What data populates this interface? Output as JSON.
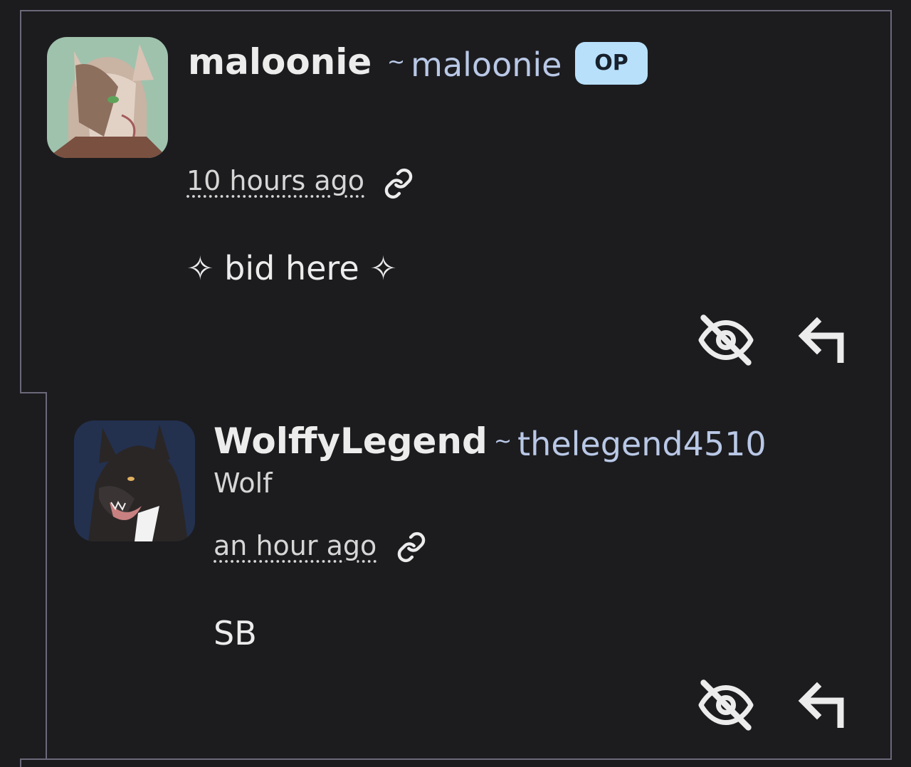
{
  "comments": [
    {
      "display_name": "maloonie",
      "username_prefix": "~",
      "username": "maloonie",
      "badge": "OP",
      "species": "",
      "timestamp": "10 hours ago",
      "body": "✧ bid here ✧",
      "icons": {
        "permalink": "link-icon",
        "hide": "eye-off-icon",
        "reply": "reply-arrow-icon"
      }
    },
    {
      "display_name": "WolffyLegend",
      "username_prefix": "~",
      "username": "thelegend4510",
      "badge": "",
      "species": "Wolf",
      "timestamp": "an hour ago",
      "body": "SB",
      "icons": {
        "permalink": "link-icon",
        "hide": "eye-off-icon",
        "reply": "reply-arrow-icon"
      }
    }
  ],
  "colors": {
    "background": "#1c1c1f",
    "border": "#6b6879",
    "username": "#b9c8e6",
    "op_badge_bg": "#b8e0fb",
    "text": "#ececec"
  }
}
